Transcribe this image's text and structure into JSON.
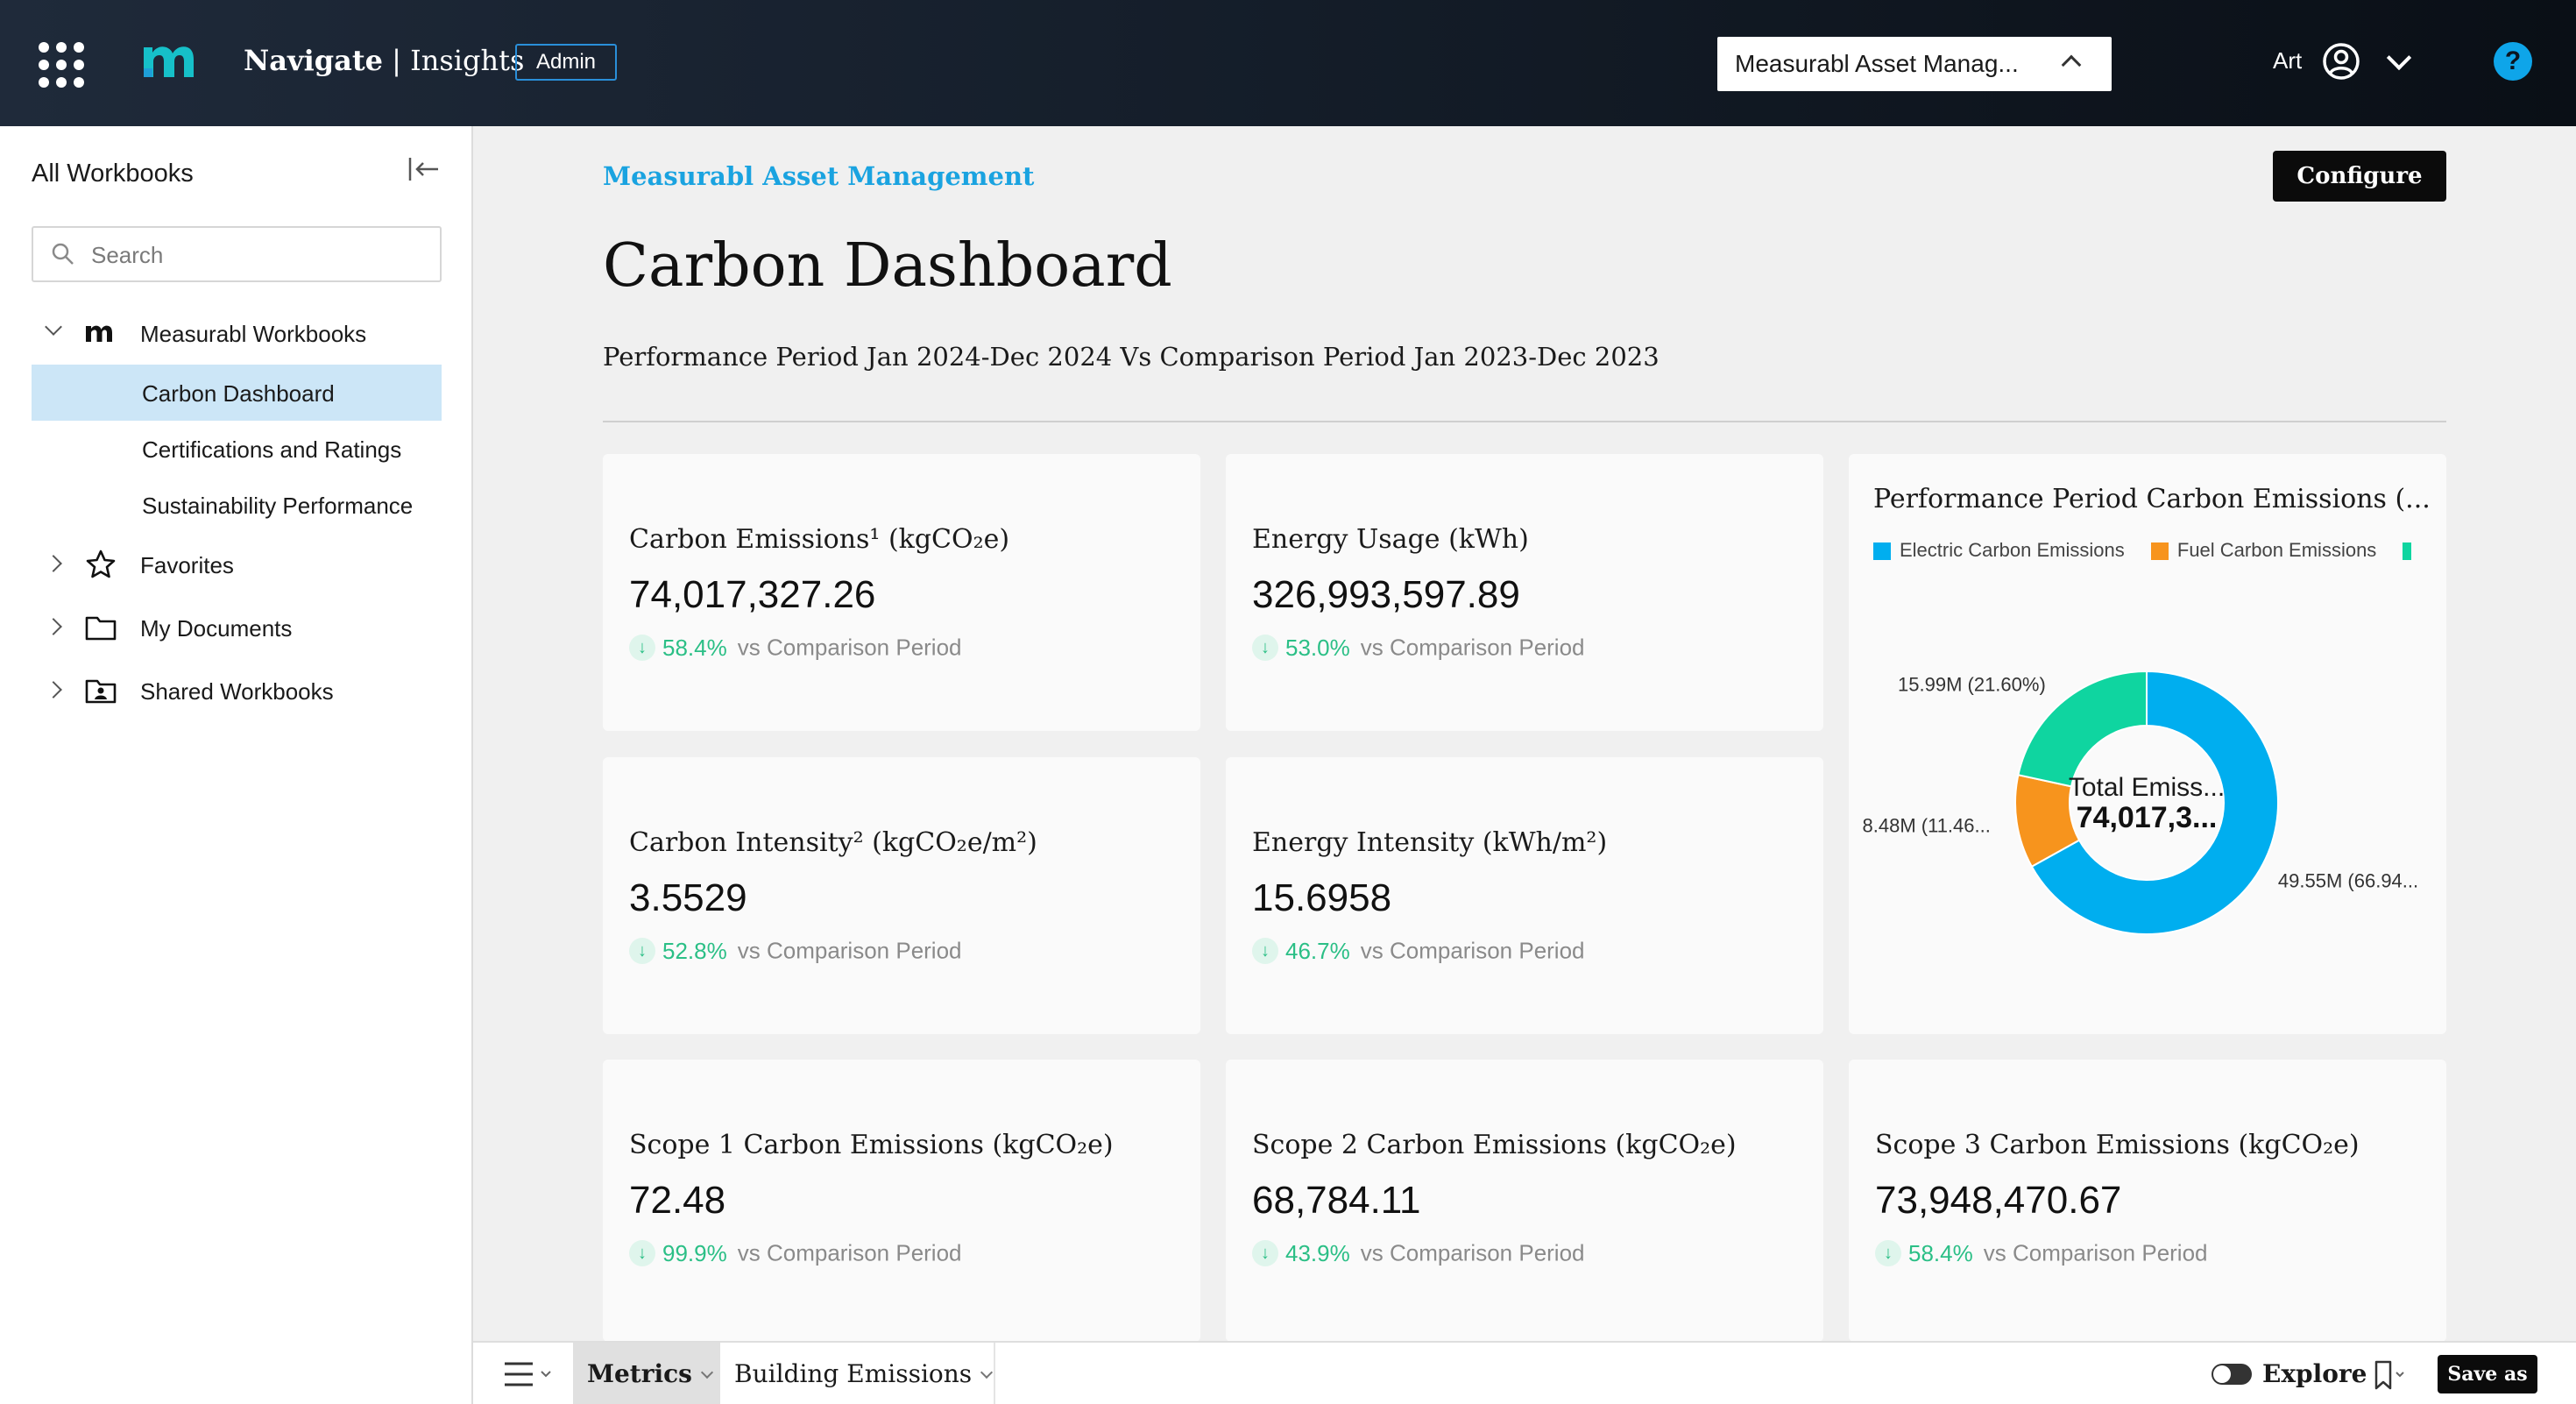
{
  "header": {
    "brand_bold": "Navigate",
    "brand_rest": "| Insights",
    "admin_badge": "Admin",
    "org_selector": "Measurabl Asset Manag...",
    "user_name": "Art",
    "help": "?"
  },
  "sidebar": {
    "title": "All Workbooks",
    "search_placeholder": "Search",
    "items": [
      {
        "label": "Measurabl Workbooks",
        "icon": "measurabl-logo-icon",
        "expanded": true
      },
      {
        "label": "Carbon Dashboard",
        "selected": true
      },
      {
        "label": "Certifications and Ratings"
      },
      {
        "label": "Sustainability Performance"
      },
      {
        "label": "Favorites",
        "icon": "star-icon"
      },
      {
        "label": "My Documents",
        "icon": "folder-icon"
      },
      {
        "label": "Shared Workbooks",
        "icon": "shared-folder-icon"
      }
    ]
  },
  "main": {
    "breadcrumb": "Measurabl Asset Management",
    "configure_label": "Configure",
    "title": "Carbon Dashboard",
    "period": "Performance Period Jan 2024-Dec 2024 Vs Comparison Period Jan 2023-Dec 2023",
    "cards": [
      {
        "title": "Carbon Emissions¹ (kgCO₂e)",
        "value": "74,017,327.26",
        "delta": "58.4%",
        "compare": "vs Comparison Period"
      },
      {
        "title": "Energy Usage (kWh)",
        "value": "326,993,597.89",
        "delta": "53.0%",
        "compare": "vs Comparison Period"
      },
      {
        "title": "Carbon Intensity² (kgCO₂e/m²)",
        "value": "3.5529",
        "delta": "52.8%",
        "compare": "vs Comparison Period"
      },
      {
        "title": "Energy Intensity (kWh/m²)",
        "value": "15.6958",
        "delta": "46.7%",
        "compare": "vs Comparison Period"
      },
      {
        "title": "Scope 1 Carbon Emissions (kgCO₂e)",
        "value": "72.48",
        "delta": "99.9%",
        "compare": "vs Comparison Period"
      },
      {
        "title": "Scope 2 Carbon Emissions (kgCO₂e)",
        "value": "68,784.11",
        "delta": "43.9%",
        "compare": "vs Comparison Period"
      },
      {
        "title": "Scope 3 Carbon Emissions (kgCO₂e)",
        "value": "73,948,470.67",
        "delta": "58.4%",
        "compare": "vs Comparison Period"
      }
    ]
  },
  "chart_data": {
    "type": "pie",
    "title": "Performance Period Carbon Emissions (...",
    "legend": [
      {
        "name": "Electric Carbon Emissions",
        "color": "#00aeef"
      },
      {
        "name": "Fuel Carbon Emissions",
        "color": "#f7941d"
      },
      {
        "name": "",
        "color": "#0fd5a0"
      }
    ],
    "slices": [
      {
        "value": 66.94,
        "label": "49.55M (66.94...",
        "color": "#00aeef"
      },
      {
        "value": 11.46,
        "label": "8.48M (11.46...",
        "color": "#f7941d"
      },
      {
        "value": 21.6,
        "label": "15.99M (21.60%)",
        "color": "#0fd5a0"
      }
    ],
    "center_label": "Total Emiss...",
    "center_value": "74,017,3..."
  },
  "bottom": {
    "tabs": [
      {
        "label": "Metrics",
        "active": true
      },
      {
        "label": "Building Emissions",
        "active": false
      }
    ],
    "explore_label": "Explore",
    "save_as_label": "Save as"
  },
  "colors": {
    "accent_blue": "#1aa3e0",
    "positive_green": "#2bbf86",
    "selected_bg": "#cce6f7"
  }
}
